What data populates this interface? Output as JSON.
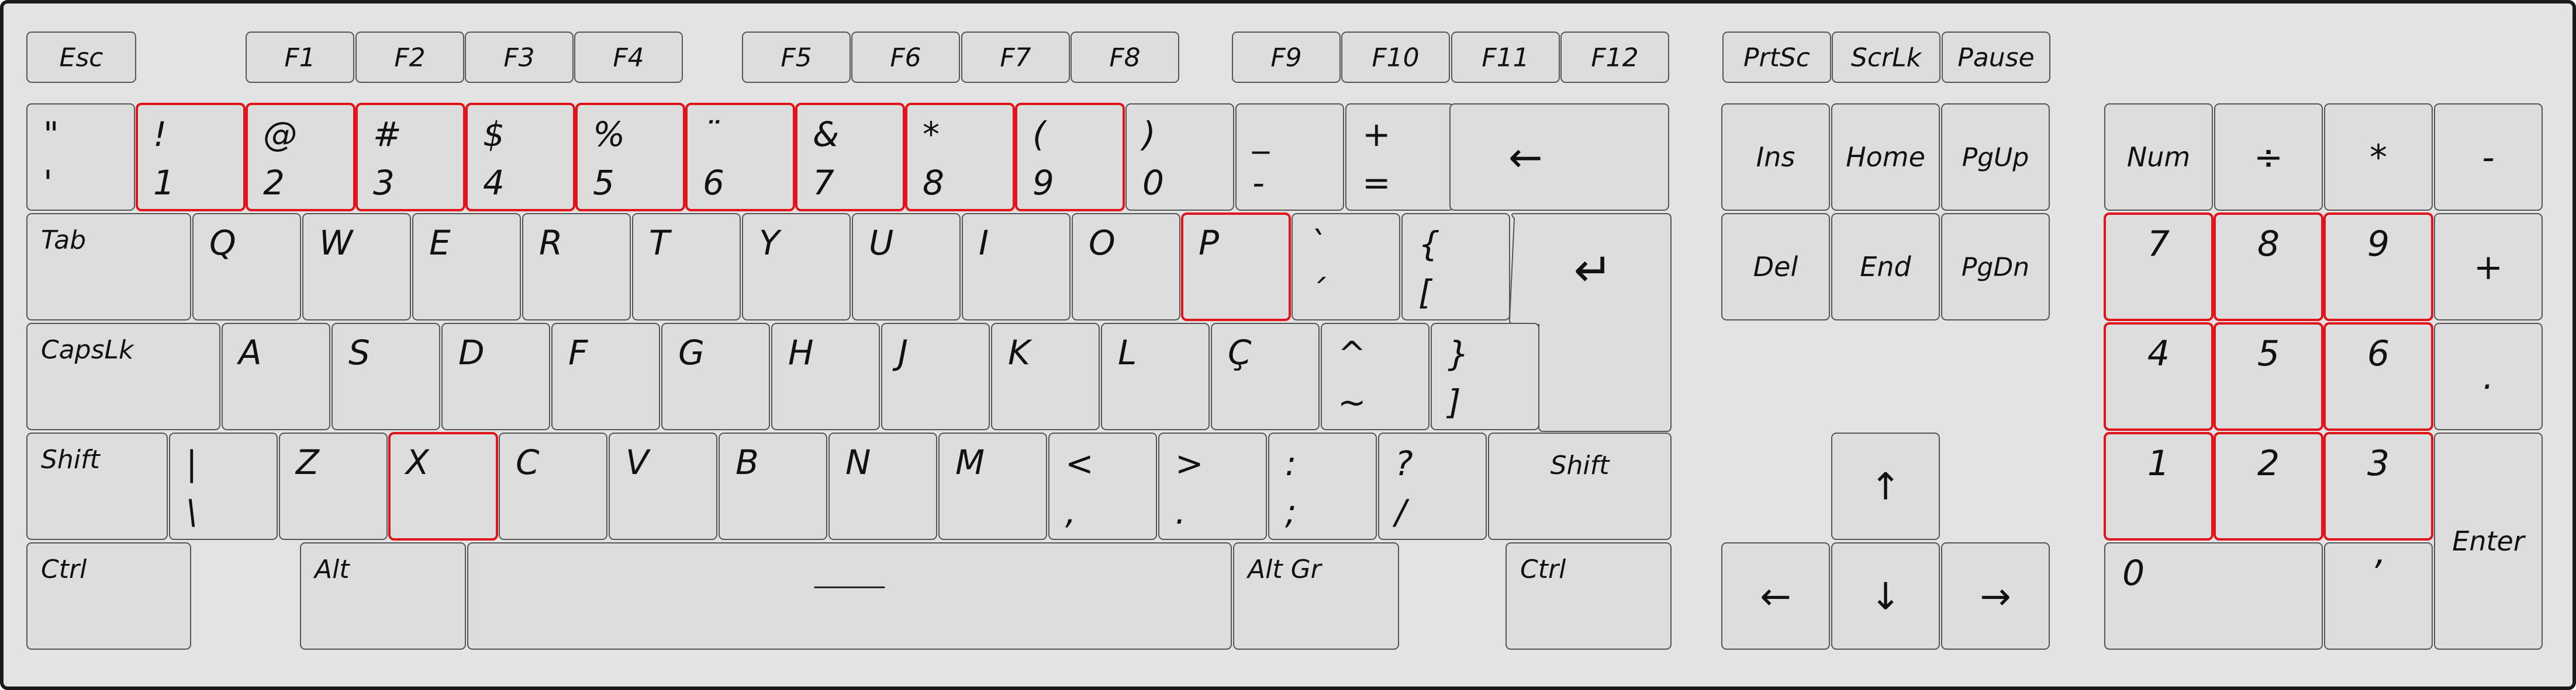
{
  "colors": {
    "board_fill": "#e3e3e3",
    "board_border": "#1a1a1a",
    "key_fill": "#dddddd",
    "key_border": "#555555",
    "highlight_border": "#e0141b",
    "legend": "#111111"
  },
  "function_row": {
    "esc": "Esc",
    "f1": "F1",
    "f2": "F2",
    "f3": "F3",
    "f4": "F4",
    "f5": "F5",
    "f6": "F6",
    "f7": "F7",
    "f8": "F8",
    "f9": "F9",
    "f10": "F10",
    "f11": "F11",
    "f12": "F12",
    "prtsc": "PrtSc",
    "scrlk": "ScrLk",
    "pause": "Pause"
  },
  "number_row": [
    {
      "id": "quote",
      "top": "\"",
      "bottom": "'",
      "highlighted": false
    },
    {
      "id": "1",
      "top": "!",
      "bottom": "1",
      "highlighted": true
    },
    {
      "id": "2",
      "top": "@",
      "bottom": "2",
      "highlighted": true
    },
    {
      "id": "3",
      "top": "#",
      "bottom": "3",
      "highlighted": true
    },
    {
      "id": "4",
      "top": "$",
      "bottom": "4",
      "highlighted": true
    },
    {
      "id": "5",
      "top": "%",
      "bottom": "5",
      "highlighted": true
    },
    {
      "id": "6",
      "top": "¨",
      "bottom": "6",
      "highlighted": true
    },
    {
      "id": "7",
      "top": "&",
      "bottom": "7",
      "highlighted": true
    },
    {
      "id": "8",
      "top": "*",
      "bottom": "8",
      "highlighted": true
    },
    {
      "id": "9",
      "top": "(",
      "bottom": "9",
      "highlighted": true
    },
    {
      "id": "0",
      "top": ")",
      "bottom": "0",
      "highlighted": false
    },
    {
      "id": "minus",
      "top": "_",
      "bottom": "-",
      "highlighted": false
    },
    {
      "id": "equals",
      "top": "+",
      "bottom": "=",
      "highlighted": false
    }
  ],
  "backspace_arrow": "←",
  "row_q": {
    "tab": "Tab",
    "letters": [
      {
        "label": "Q",
        "highlighted": false
      },
      {
        "label": "W",
        "highlighted": false
      },
      {
        "label": "E",
        "highlighted": false
      },
      {
        "label": "R",
        "highlighted": false
      },
      {
        "label": "T",
        "highlighted": false
      },
      {
        "label": "Y",
        "highlighted": false
      },
      {
        "label": "U",
        "highlighted": false
      },
      {
        "label": "I",
        "highlighted": false
      },
      {
        "label": "O",
        "highlighted": false
      },
      {
        "label": "P",
        "highlighted": true
      }
    ],
    "acute": {
      "top": "`",
      "bottom": "´"
    },
    "brace": {
      "top": "{",
      "bottom": "["
    },
    "enter_arrow": "↵"
  },
  "row_a": {
    "capslock": "CapsLk",
    "letters": [
      "A",
      "S",
      "D",
      "F",
      "G",
      "H",
      "J",
      "K",
      "L",
      "Ç"
    ],
    "tilde": {
      "top": "^",
      "bottom": "~"
    },
    "brace": {
      "top": "}",
      "bottom": "]"
    }
  },
  "row_z": {
    "shift_left": "Shift",
    "pipe": {
      "top": "|",
      "bottom": "\\"
    },
    "letters": [
      {
        "label": "Z",
        "highlighted": false
      },
      {
        "label": "X",
        "highlighted": true
      },
      {
        "label": "C",
        "highlighted": false
      },
      {
        "label": "V",
        "highlighted": false
      },
      {
        "label": "B",
        "highlighted": false
      },
      {
        "label": "N",
        "highlighted": false
      },
      {
        "label": "M",
        "highlighted": false
      }
    ],
    "comma": {
      "top": "<",
      "bottom": ","
    },
    "period": {
      "top": ">",
      "bottom": "."
    },
    "semicolon": {
      "top": ":",
      "bottom": ";"
    },
    "slash": {
      "top": "?",
      "bottom": "/"
    },
    "shift_right": "Shift"
  },
  "bottom_row": {
    "ctrl_left": "Ctrl",
    "alt": "Alt",
    "space": "______",
    "altgr": "Alt Gr",
    "ctrl_right": "Ctrl"
  },
  "navigation": {
    "ins": "Ins",
    "home": "Home",
    "pgup": "PgUp",
    "del": "Del",
    "end": "End",
    "pgdn": "PgDn"
  },
  "arrows": {
    "up": "↑",
    "left": "←",
    "down": "↓",
    "right": "→"
  },
  "numpad": {
    "num": "Num",
    "divide": "÷",
    "multiply": "*",
    "minus": "-",
    "plus": "+",
    "decimal": ".",
    "enter": "Enter",
    "zero": "0",
    "comma": "ʼ",
    "digits": [
      {
        "label": "7",
        "highlighted": true
      },
      {
        "label": "8",
        "highlighted": true
      },
      {
        "label": "9",
        "highlighted": true
      },
      {
        "label": "4",
        "highlighted": true
      },
      {
        "label": "5",
        "highlighted": true
      },
      {
        "label": "6",
        "highlighted": true
      },
      {
        "label": "1",
        "highlighted": true
      },
      {
        "label": "2",
        "highlighted": true
      },
      {
        "label": "3",
        "highlighted": true
      }
    ]
  }
}
